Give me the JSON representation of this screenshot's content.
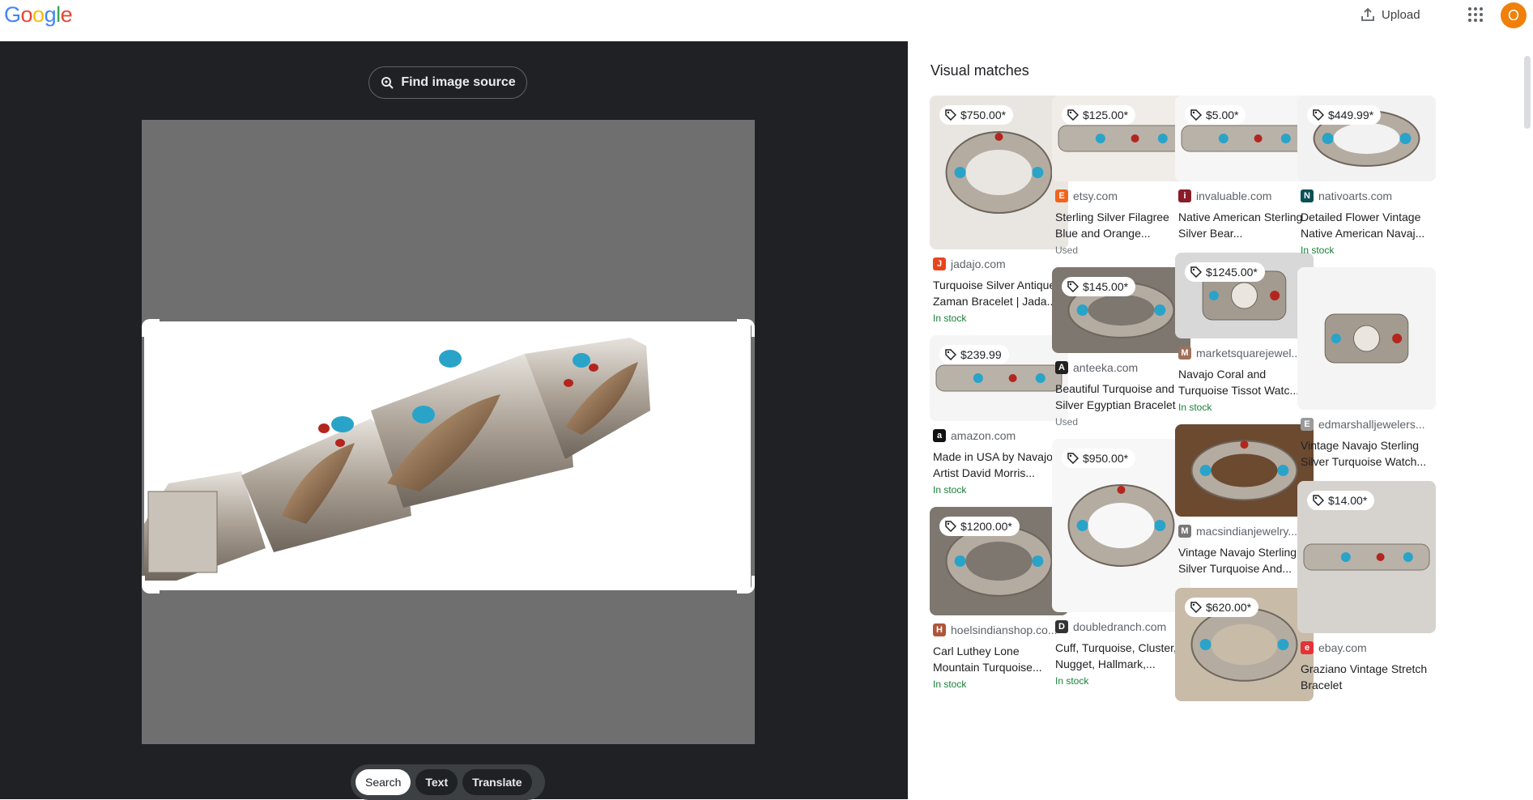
{
  "header": {
    "logo_letters": [
      {
        "ch": "G",
        "color": "#4285F4"
      },
      {
        "ch": "o",
        "color": "#EA4335"
      },
      {
        "ch": "o",
        "color": "#FBBC05"
      },
      {
        "ch": "g",
        "color": "#4285F4"
      },
      {
        "ch": "l",
        "color": "#34A853"
      },
      {
        "ch": "e",
        "color": "#EA4335"
      }
    ],
    "upload_label": "Upload",
    "avatar_letter": "O"
  },
  "viewer": {
    "find_source_label": "Find image source",
    "modes": [
      {
        "label": "Search",
        "active": true
      },
      {
        "label": "Text",
        "active": false
      },
      {
        "label": "Translate",
        "active": false
      }
    ]
  },
  "results": {
    "title": "Visual matches",
    "columns": [
      [
        {
          "price": "$750.00*",
          "source": "jadajo.com",
          "fav": "J",
          "fav_color": "#e8451a",
          "title": "Turquoise Silver Antique Zaman Bracelet | Jada...",
          "stock": "In stock",
          "thumb_h": 190,
          "thumb": "cuff-tall"
        },
        {
          "price": "$239.99",
          "source": "amazon.com",
          "fav": "a",
          "fav_color": "#111111",
          "title": "Made in USA by Navajo Artist David Morris...",
          "stock": "In stock",
          "thumb_h": 106,
          "thumb": "band"
        },
        {
          "price": "$1200.00*",
          "source": "hoelsindianshop.co...",
          "fav": "H",
          "fav_color": "#b0563a",
          "title": "Carl Luthey Lone Mountain Turquoise...",
          "stock": "In stock",
          "thumb_h": 134,
          "thumb": "cuff-dark"
        }
      ],
      [
        {
          "price": "$125.00*",
          "source": "etsy.com",
          "fav": "E",
          "fav_color": "#f1641e",
          "title": "Sterling Silver Filagree Blue and Orange...",
          "stock": "Used",
          "thumb_h": 106,
          "thumb": "sand"
        },
        {
          "price": "$145.00*",
          "source": "anteeka.com",
          "fav": "A",
          "fav_color": "#222222",
          "title": "Beautiful Turquoise and Silver Egyptian Bracelet",
          "stock": "Used",
          "thumb_h": 106,
          "thumb": "cuff-dark"
        },
        {
          "price": "$950.00*",
          "source": "doubledranch.com",
          "fav": "D",
          "fav_color": "#333333",
          "title": "Cuff, Turquoise, Cluster, Nugget, Hallmark,...",
          "stock": "In stock",
          "thumb_h": 214,
          "thumb": "cuff-light"
        }
      ],
      [
        {
          "price": "$5.00*",
          "source": "invaluable.com",
          "fav": "i",
          "fav_color": "#8a1c2a",
          "title": "Native American Sterling Silver Bear...",
          "stock": "",
          "thumb_h": 106,
          "thumb": "band-light"
        },
        {
          "price": "$1245.00*",
          "source": "marketsquarejewel...",
          "fav": "M",
          "fav_color": "#a0705a",
          "title": "Navajo Coral and Turquoise Tissot Watc...",
          "stock": "In stock",
          "thumb_h": 106,
          "thumb": "watch"
        },
        {
          "price": "",
          "source": "macsindianjewelry....",
          "fav": "M",
          "fav_color": "#777777",
          "title": "Vintage Navajo Sterling Silver Turquoise And...",
          "stock": "",
          "thumb_h": 114,
          "thumb": "wood"
        },
        {
          "price": "$620.00*",
          "source": "",
          "fav": "",
          "fav_color": "#ffffff",
          "title": "",
          "stock": "",
          "thumb_h": 140,
          "thumb": "rug"
        }
      ],
      [
        {
          "price": "$449.99*",
          "source": "nativoarts.com",
          "fav": "N",
          "fav_color": "#0a4f55",
          "title": "Detailed Flower Vintage Native American Navaj...",
          "stock": "In stock",
          "thumb_h": 106,
          "thumb": "cuff-turq"
        },
        {
          "price": "",
          "source": "edmarshalljewelers...",
          "fav": "E",
          "fav_color": "#9a9a9a",
          "title": "Vintage Navajo Sterling Silver Turquoise Watch...",
          "stock": "",
          "thumb_h": 176,
          "thumb": "watch-side"
        },
        {
          "price": "$14.00*",
          "source": "ebay.com",
          "fav": "e",
          "fav_color": "#e53238",
          "title": "Graziano Vintage Stretch Bracelet",
          "stock": "",
          "thumb_h": 188,
          "thumb": "stretch"
        }
      ]
    ]
  }
}
